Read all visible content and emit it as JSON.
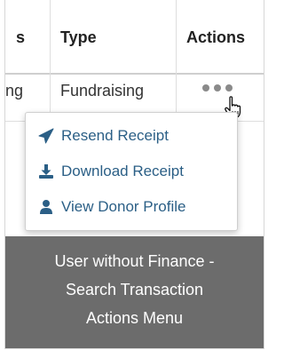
{
  "table": {
    "headers": [
      "s",
      "Type",
      "Actions"
    ],
    "row": [
      "ng",
      "Fundraising"
    ]
  },
  "actions_menu": {
    "trigger_icon": "ellipsis-icon",
    "items": [
      {
        "label": "Resend Receipt",
        "icon": "paper-plane-icon"
      },
      {
        "label": "Download Receipt",
        "icon": "download-icon"
      },
      {
        "label": "View Donor Profile",
        "icon": "user-icon"
      }
    ]
  },
  "caption": {
    "lines": [
      "User without Finance -",
      "Search Transaction",
      "Actions Menu"
    ]
  },
  "colors": {
    "menu_text": "#2b5f86",
    "caption_bg": "#6c6c6c",
    "dots": "#8a8a8a"
  }
}
